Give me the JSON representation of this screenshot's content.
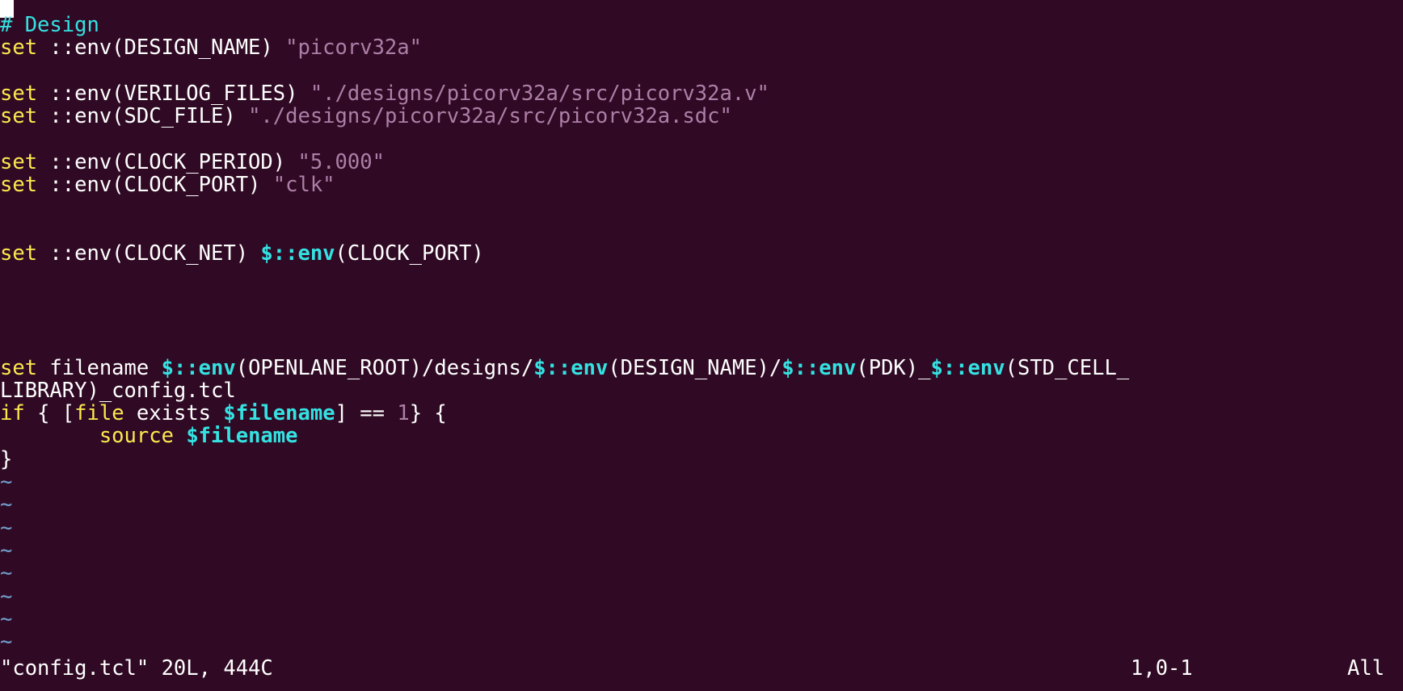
{
  "colors": {
    "background": "#300a24",
    "text": "#ffffff",
    "comment": "#34e2e2",
    "keyword": "#fce94f",
    "string": "#ad7fa8",
    "variable": "#34e2e2",
    "number": "#ad7fa8",
    "tilde": "#729fcf"
  },
  "editor": {
    "lines": [
      [
        {
          "t": "# Design",
          "c": "comment"
        }
      ],
      [
        {
          "t": "set",
          "c": "keyword"
        },
        {
          "t": " ::env(DESIGN_NAME) ",
          "c": "plain"
        },
        {
          "t": "\"picorv32a\"",
          "c": "string"
        }
      ],
      [],
      [
        {
          "t": "set",
          "c": "keyword"
        },
        {
          "t": " ::env(VERILOG_FILES) ",
          "c": "plain"
        },
        {
          "t": "\"./designs/picorv32a/src/picorv32a.v\"",
          "c": "string"
        }
      ],
      [
        {
          "t": "set",
          "c": "keyword"
        },
        {
          "t": " ::env(SDC_FILE) ",
          "c": "plain"
        },
        {
          "t": "\"./designs/picorv32a/src/picorv32a.sdc\"",
          "c": "string"
        }
      ],
      [],
      [
        {
          "t": "set",
          "c": "keyword"
        },
        {
          "t": " ::env(CLOCK_PERIOD) ",
          "c": "plain"
        },
        {
          "t": "\"5.000\"",
          "c": "string"
        }
      ],
      [
        {
          "t": "set",
          "c": "keyword"
        },
        {
          "t": " ::env(CLOCK_PORT) ",
          "c": "plain"
        },
        {
          "t": "\"clk\"",
          "c": "string"
        }
      ],
      [],
      [],
      [
        {
          "t": "set",
          "c": "keyword"
        },
        {
          "t": " ::env(CLOCK_NET) ",
          "c": "plain"
        },
        {
          "t": "$::env",
          "c": "var"
        },
        {
          "t": "(CLOCK_PORT)",
          "c": "plain"
        }
      ],
      [],
      [],
      [],
      [],
      [
        {
          "t": "set",
          "c": "keyword"
        },
        {
          "t": " filename ",
          "c": "plain"
        },
        {
          "t": "$::env",
          "c": "var"
        },
        {
          "t": "(OPENLANE_ROOT)/designs/",
          "c": "plain"
        },
        {
          "t": "$::env",
          "c": "var"
        },
        {
          "t": "(DESIGN_NAME)/",
          "c": "plain"
        },
        {
          "t": "$::env",
          "c": "var"
        },
        {
          "t": "(PDK)_",
          "c": "plain"
        },
        {
          "t": "$::env",
          "c": "var"
        },
        {
          "t": "(STD_CELL_",
          "c": "plain"
        }
      ],
      [
        {
          "t": "LIBRARY)_config.tcl",
          "c": "plain"
        }
      ],
      [
        {
          "t": "if",
          "c": "keyword"
        },
        {
          "t": " { [",
          "c": "plain"
        },
        {
          "t": "file",
          "c": "keyword"
        },
        {
          "t": " exists ",
          "c": "plain"
        },
        {
          "t": "$filename",
          "c": "var"
        },
        {
          "t": "] == ",
          "c": "plain"
        },
        {
          "t": "1",
          "c": "number"
        },
        {
          "t": "} {",
          "c": "plain"
        }
      ],
      [
        {
          "t": "        ",
          "c": "plain"
        },
        {
          "t": "source",
          "c": "keyword"
        },
        {
          "t": " ",
          "c": "plain"
        },
        {
          "t": "$filename",
          "c": "var"
        }
      ],
      [
        {
          "t": "}",
          "c": "plain"
        }
      ]
    ],
    "tilde_rows": [
      "~",
      "~",
      "~",
      "~",
      "~",
      "~",
      "~",
      "~"
    ]
  },
  "status": {
    "message": "\"config.tcl\" 20L, 444C",
    "position": "1,0-1",
    "scroll": "All"
  }
}
